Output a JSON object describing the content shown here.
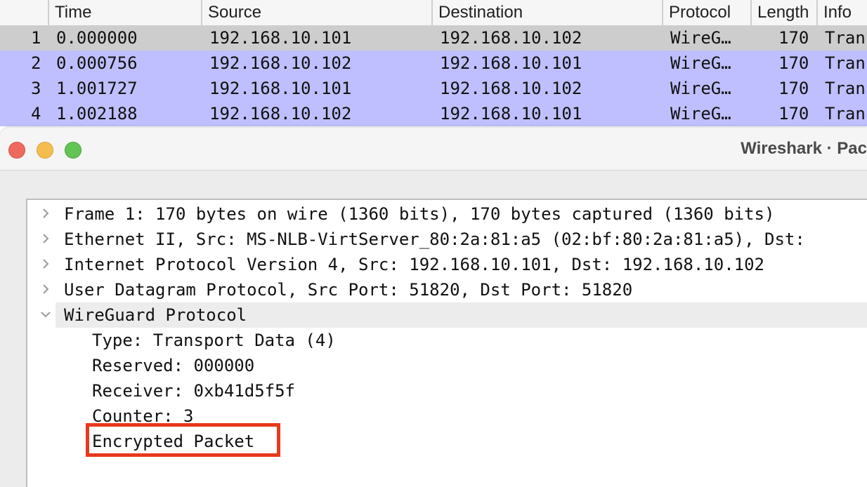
{
  "packet_list": {
    "columns": [
      "Time",
      "Source",
      "Destination",
      "Protocol",
      "Length",
      "Info"
    ],
    "rows": [
      {
        "no": "1",
        "time": "0.000000",
        "source": "192.168.10.101",
        "destination": "192.168.10.102",
        "protocol": "WireG…",
        "length": "170",
        "info": "Tran"
      },
      {
        "no": "2",
        "time": "0.000756",
        "source": "192.168.10.102",
        "destination": "192.168.10.101",
        "protocol": "WireG…",
        "length": "170",
        "info": "Tran"
      },
      {
        "no": "3",
        "time": "1.001727",
        "source": "192.168.10.101",
        "destination": "192.168.10.102",
        "protocol": "WireG…",
        "length": "170",
        "info": "Tran"
      },
      {
        "no": "4",
        "time": "1.002188",
        "source": "192.168.10.102",
        "destination": "192.168.10.101",
        "protocol": "WireG…",
        "length": "170",
        "info": "Tran"
      }
    ],
    "colors": {
      "selected": "#cdcdcd",
      "highlight": "#bfbfff"
    }
  },
  "detail_window": {
    "title": "Wireshark · Pac",
    "tree": [
      {
        "label": "Frame 1: 170 bytes on wire (1360 bits), 170 bytes captured (1360 bits)",
        "expanded": false
      },
      {
        "label": "Ethernet II, Src: MS-NLB-VirtServer_80:2a:81:a5 (02:bf:80:2a:81:a5), Dst:",
        "expanded": false
      },
      {
        "label": "Internet Protocol Version 4, Src: 192.168.10.101, Dst: 192.168.10.102",
        "expanded": false
      },
      {
        "label": "User Datagram Protocol, Src Port: 51820, Dst Port: 51820",
        "expanded": false
      },
      {
        "label": "WireGuard Protocol",
        "expanded": true
      }
    ],
    "wireguard_fields": [
      "Type: Transport Data (4)",
      "Reserved: 000000",
      "Receiver: 0xb41d5f5f",
      "Counter: 3",
      "Encrypted Packet"
    ],
    "annotation_color": "#e8391d"
  }
}
